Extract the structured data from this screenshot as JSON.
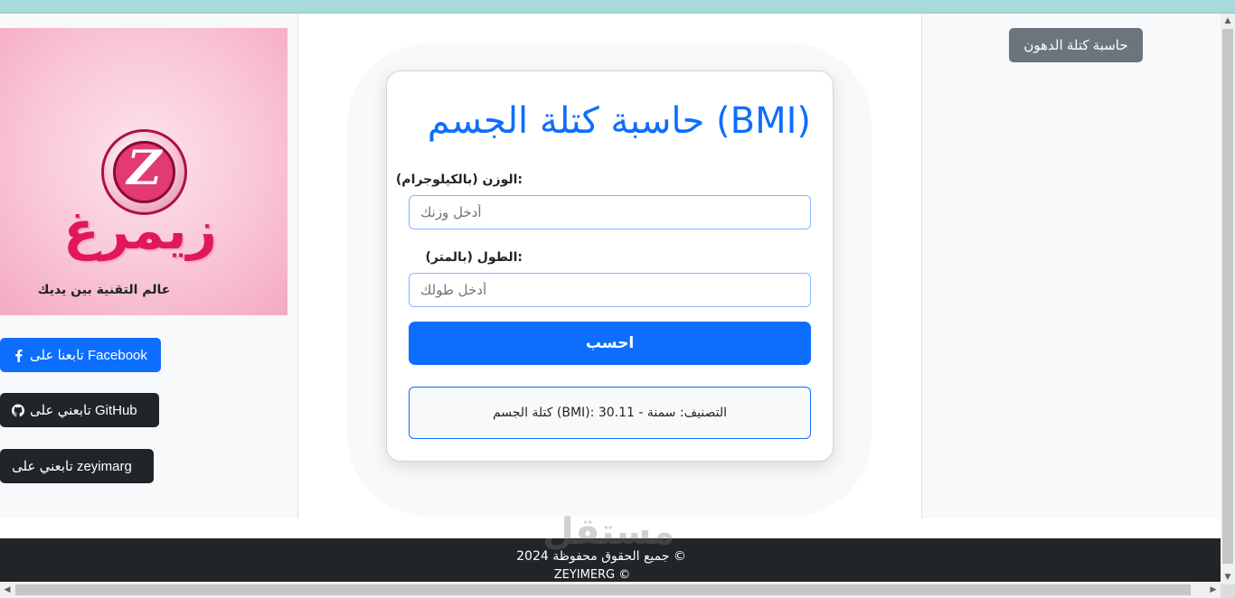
{
  "colors": {
    "primary": "#0d6efd",
    "dark": "#212529",
    "secondary": "#6c757d",
    "topbar": "#a8dadc"
  },
  "nav": {
    "fat_calc_button": "حاسبة كتلة الدهون"
  },
  "logo": {
    "brand": "زيمرغ",
    "tagline": "عالم التقنية بين يديك",
    "monogram": "Z"
  },
  "social": {
    "facebook": "تابعنا على Facebook",
    "github": "تابعني على GitHub",
    "zeyimarg": "تابعني على zeyimarg"
  },
  "icons": {
    "facebook": "facebook-icon",
    "github": "github-icon"
  },
  "form": {
    "title": "(BMI) حاسبة كتلة الجسم",
    "weight_label": ":الوزن (بالكيلوجرام)",
    "weight_placeholder": "أدخل وزنك",
    "height_label": ":الطول (بالمتر)",
    "height_placeholder": "أدخل طولك",
    "calculate_button": "احسب",
    "result": "التصنيف: سمنة - 30.11 :(BMI) كتلة الجسم"
  },
  "footer": {
    "copyright": "جميع الحقوق محفوظة 2024 ©",
    "brand": "ZEYIMERG ©"
  },
  "watermark": "مستقل"
}
